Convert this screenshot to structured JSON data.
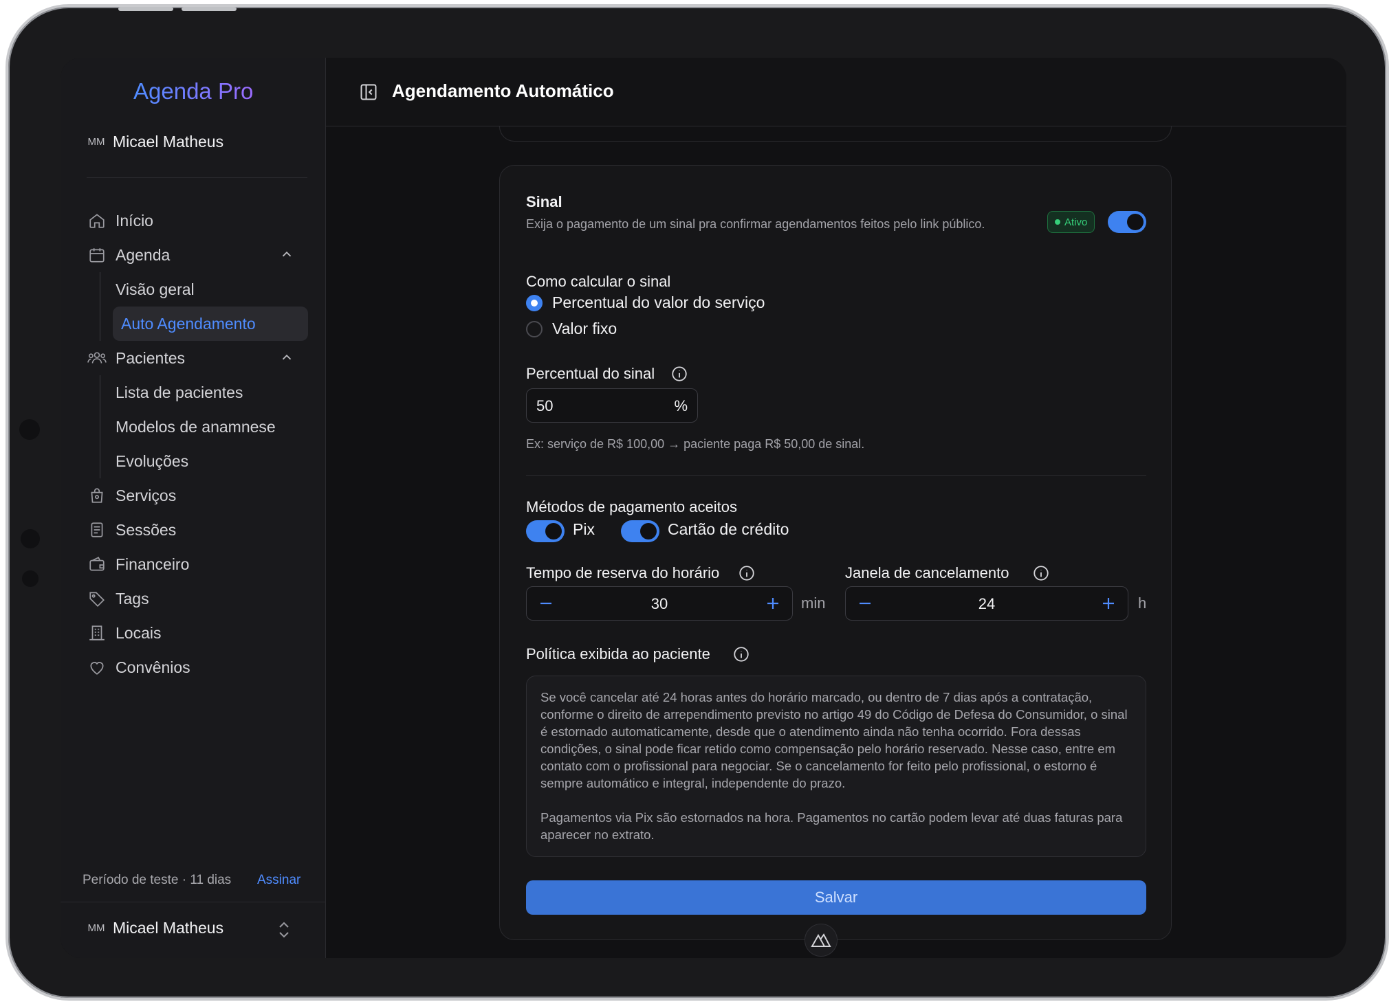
{
  "app": {
    "brand": "Agenda Pro"
  },
  "user": {
    "initials": "MM",
    "name": "Micael Matheus"
  },
  "sidebar": {
    "items": [
      {
        "label": "Início",
        "icon": "home-icon"
      },
      {
        "label": "Agenda",
        "icon": "calendar-icon",
        "expanded": true,
        "children": [
          {
            "label": "Visão geral"
          },
          {
            "label": "Auto Agendamento",
            "active": true
          }
        ]
      },
      {
        "label": "Pacientes",
        "icon": "users-icon",
        "expanded": true,
        "children": [
          {
            "label": "Lista de pacientes"
          },
          {
            "label": "Modelos de anamnese"
          },
          {
            "label": "Evoluções"
          }
        ]
      },
      {
        "label": "Serviços",
        "icon": "shopping-bag-icon"
      },
      {
        "label": "Sessões",
        "icon": "document-icon"
      },
      {
        "label": "Financeiro",
        "icon": "wallet-icon"
      },
      {
        "label": "Tags",
        "icon": "tag-icon"
      },
      {
        "label": "Locais",
        "icon": "building-icon"
      },
      {
        "label": "Convênios",
        "icon": "heart-icon"
      }
    ],
    "trial_text": "Período de teste · 11 dias",
    "subscribe_label": "Assinar"
  },
  "header": {
    "title": "Agendamento Automático"
  },
  "sinal": {
    "title": "Sinal",
    "description": "Exija o pagamento de um sinal pra confirmar agendamentos feitos pelo link público.",
    "status_badge": "Ativo",
    "enabled": true,
    "calc_label": "Como calcular o sinal",
    "calc_options": [
      {
        "label": "Percentual do valor do serviço",
        "selected": true
      },
      {
        "label": "Valor fixo",
        "selected": false
      }
    ],
    "percent_label": "Percentual do sinal",
    "percent_value": "50",
    "percent_unit": "%",
    "example": "Ex: serviço de R$ 100,00 → paciente paga R$ 50,00 de sinal."
  },
  "payment": {
    "label": "Métodos de pagamento aceitos",
    "methods": [
      {
        "label": "Pix",
        "enabled": true
      },
      {
        "label": "Cartão de crédito",
        "enabled": true
      }
    ]
  },
  "reserve": {
    "label": "Tempo de reserva do horário",
    "value": "30",
    "unit": "min"
  },
  "cancel_window": {
    "label": "Janela de cancelamento",
    "value": "24",
    "unit": "h"
  },
  "policy": {
    "label": "Política exibida ao paciente",
    "paragraph1": "Se você cancelar até 24 horas antes do horário marcado, ou dentro de 7 dias após a contratação, conforme o direito de arrependimento previsto no artigo 49 do Código de Defesa do Consumidor, o sinal é estornado automaticamente, desde que o atendimento ainda não tenha ocorrido. Fora dessas condições, o sinal pode ficar retido como compensação pelo horário reservado. Nesse caso, entre em contato com o profissional para negociar. Se o cancelamento for feito pelo profissional, o estorno é sempre automático e integral, independente do prazo.",
    "paragraph2": "Pagamentos via Pix são estornados na hora. Pagamentos no cartão podem levar até duas faturas para aparecer no extrato."
  },
  "save_label": "Salvar",
  "colors": {
    "accent": "#3e82f0",
    "active_green": "#36d07a",
    "background": "#111113"
  }
}
